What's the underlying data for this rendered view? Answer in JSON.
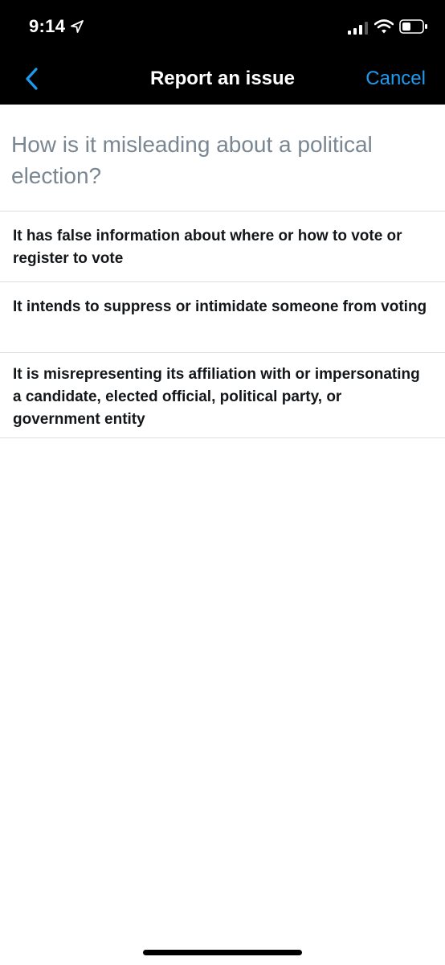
{
  "status_bar": {
    "time": "9:14",
    "icons": [
      "location-arrow-icon",
      "cellular-signal-icon",
      "wifi-icon",
      "battery-icon"
    ]
  },
  "nav": {
    "back_icon": "chevron-left-icon",
    "title": "Report an issue",
    "cancel_label": "Cancel"
  },
  "question": "How is it misleading about a political election?",
  "options": [
    {
      "label": "It has false information about where or how to vote or register to vote"
    },
    {
      "label": "It intends to suppress or intimidate someone from voting"
    },
    {
      "label": "It is misrepresenting its affiliation with or impersonating a candidate, elected official, political party, or government entity"
    }
  ],
  "colors": {
    "header_background": "#000000",
    "accent": "#1d9bf0",
    "question_text": "#7a8691",
    "option_text": "#14171a",
    "divider": "#dcdfe2"
  }
}
